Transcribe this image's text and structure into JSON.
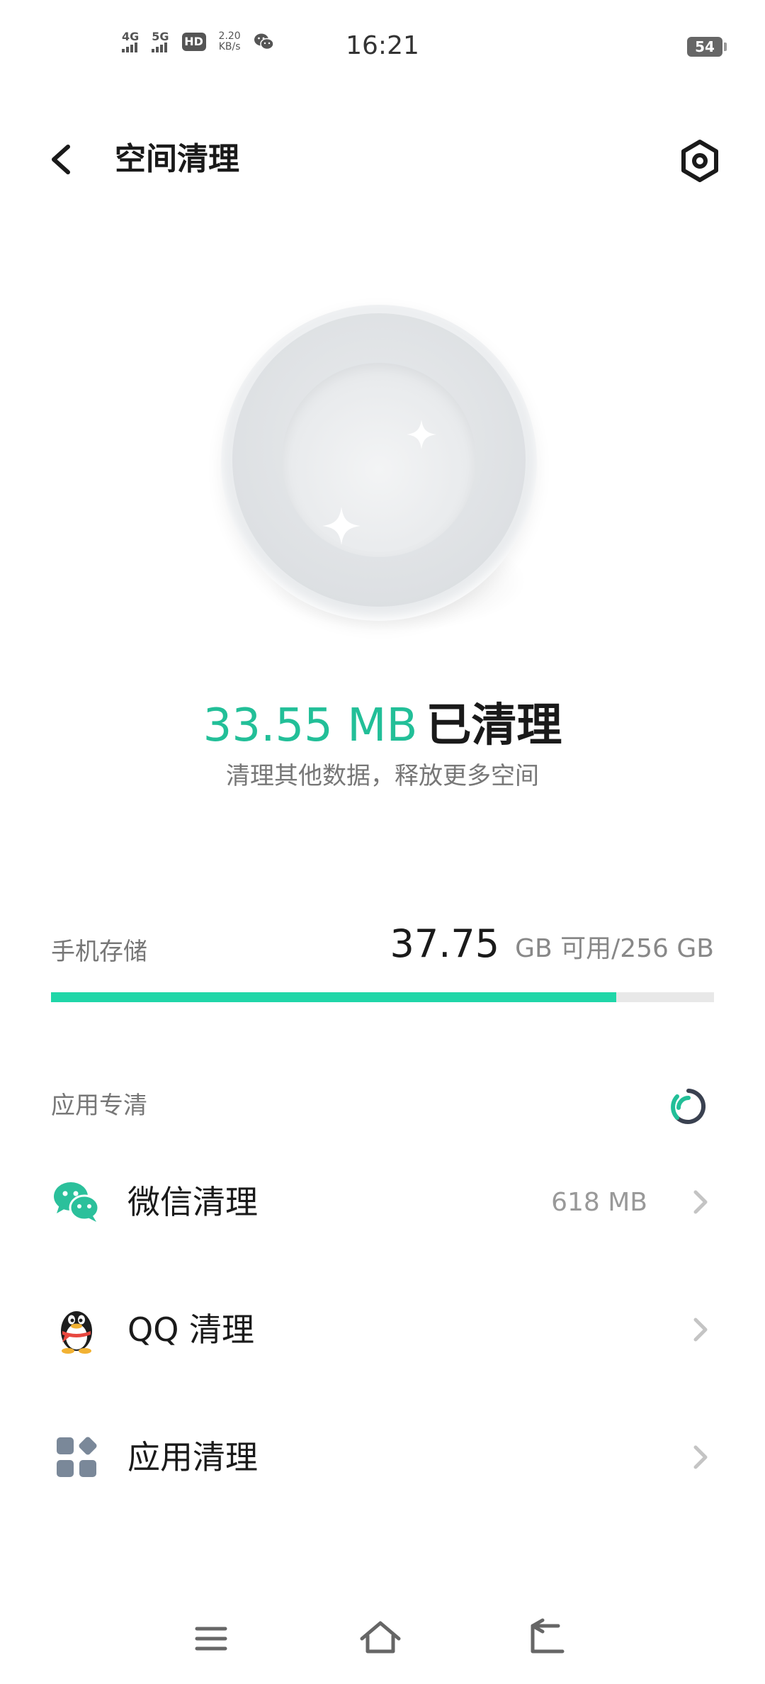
{
  "status_bar": {
    "time": "16:21",
    "network_1": "4G",
    "network_2": "5G",
    "hd_badge": "HD",
    "speed_value": "2.20",
    "speed_unit": "KB/s",
    "battery": "54"
  },
  "header": {
    "title": "空间清理",
    "back_icon": "chevron-left-icon",
    "settings_icon": "settings-hex-icon"
  },
  "result": {
    "amount": "33.55 MB",
    "label": "已清理",
    "subtitle": "清理其他数据，释放更多空间"
  },
  "storage": {
    "label": "手机存储",
    "available": "37.75",
    "unit_text": "GB 可用/256 GB",
    "used_fraction": 0.853
  },
  "section": {
    "title": "应用专清"
  },
  "items": [
    {
      "label": "微信清理",
      "size": "618 MB",
      "icon": "wechat-icon"
    },
    {
      "label": "QQ 清理",
      "size": "",
      "icon": "qq-penguin-icon"
    },
    {
      "label": "应用清理",
      "size": "",
      "icon": "apps-grid-icon"
    }
  ],
  "colors": {
    "accent": "#22bf98",
    "progress": "#1fd6a8",
    "wechat": "#2bc09b",
    "qq_scarf": "#e8473f",
    "apps": "#7a8899"
  }
}
